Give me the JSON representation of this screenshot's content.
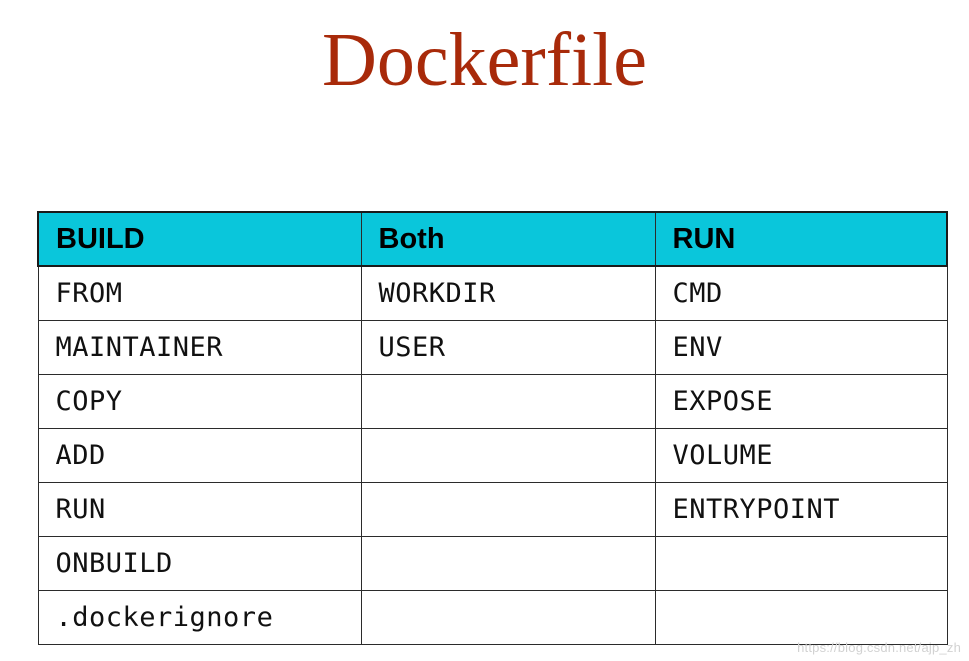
{
  "slide": {
    "title": "Dockerfile",
    "title_color": "#a82a0a",
    "background_color": "#ffffff"
  },
  "table": {
    "name": "dockerfile-directives-table",
    "header_background": "#0ac6db",
    "header_text_color": "#000000",
    "border_color": "#2b2b2b",
    "columns": [
      {
        "key": "build",
        "label": "BUILD"
      },
      {
        "key": "both",
        "label": "Both"
      },
      {
        "key": "run",
        "label": "RUN"
      }
    ],
    "rows": [
      {
        "build": "FROM",
        "both": "WORKDIR",
        "run": "CMD"
      },
      {
        "build": "MAINTAINER",
        "both": "USER",
        "run": "ENV"
      },
      {
        "build": "COPY",
        "both": "",
        "run": "EXPOSE"
      },
      {
        "build": "ADD",
        "both": "",
        "run": "VOLUME"
      },
      {
        "build": "RUN",
        "both": "",
        "run": "ENTRYPOINT"
      },
      {
        "build": "ONBUILD",
        "both": "",
        "run": ""
      },
      {
        "build": ".dockerignore",
        "both": "",
        "run": ""
      }
    ]
  },
  "watermark": {
    "text": "https://blog.csdn.net/ajp_zh"
  }
}
